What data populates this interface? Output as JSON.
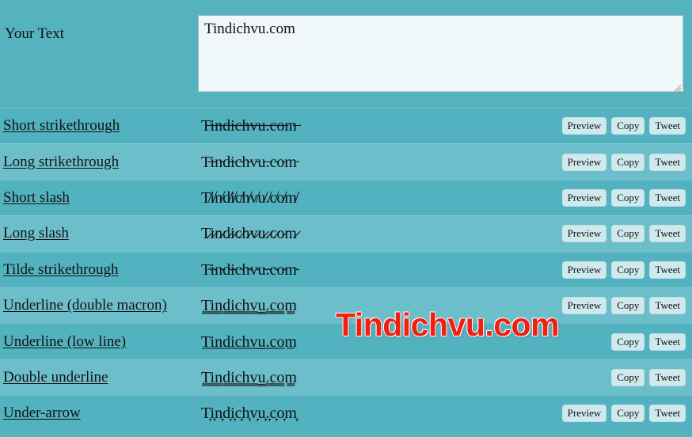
{
  "colors": {
    "background": "#55b3c0",
    "row_odd": "#52b2bf",
    "row_even": "#6cbecb",
    "textarea_bg": "#f0f7f8",
    "button_bg": "#cfe9ed",
    "watermark_red": "#f01f12",
    "text": "#111111"
  },
  "input": {
    "label": "Your Text",
    "value": "Tindichvu.com",
    "placeholder": "Enter your text here"
  },
  "watermark": {
    "text": "Tindichvu.com"
  },
  "buttons": {
    "preview": "Preview",
    "copy": "Copy",
    "tweet": "Tweet"
  },
  "rows": [
    {
      "label": "Short strikethrough",
      "sample": "T̶i̶n̶d̶i̶c̶h̶v̶u̶.̶c̶o̶m̶",
      "has_preview": true
    },
    {
      "label": "Long strikethrough",
      "sample": "T̵i̵n̵d̵i̵c̵h̵v̵u̵.̵c̵o̵m̵",
      "has_preview": true
    },
    {
      "label": "Short slash",
      "sample": "T̸i̸n̸d̸i̸c̸h̸v̸u̸.̸c̸o̸m̸",
      "has_preview": true
    },
    {
      "label": "Long slash",
      "sample": "T̷i̷n̷d̷i̷c̷h̷v̷u̷.̷c̷o̷m̷",
      "has_preview": true
    },
    {
      "label": "Tilde strikethrough",
      "sample": "T̴i̴n̴d̴i̴c̴h̴v̴u̴.̴c̴o̴m̴",
      "has_preview": true
    },
    {
      "label": "Underline (double macron)",
      "sample": "T̳i̳n̳d̳i̳c̳h̳v̳u̳.̳c̳o̳m̳",
      "has_preview": true
    },
    {
      "label": "Underline (low line)",
      "sample": "T̲i̲n̲d̲i̲c̲h̲v̲u̲.̲c̲o̲m̲",
      "has_preview": false
    },
    {
      "label": "Double underline",
      "sample": "T̳i̳n̳d̳i̳c̳h̳v̳u̳.̳c̳o̳m̳",
      "has_preview": false
    },
    {
      "label": "Under-arrow",
      "sample": "T̞i̞n̞d̞i̞c̞h̞v̞u̞.̞c̞o̞m̞",
      "has_preview": true
    }
  ]
}
